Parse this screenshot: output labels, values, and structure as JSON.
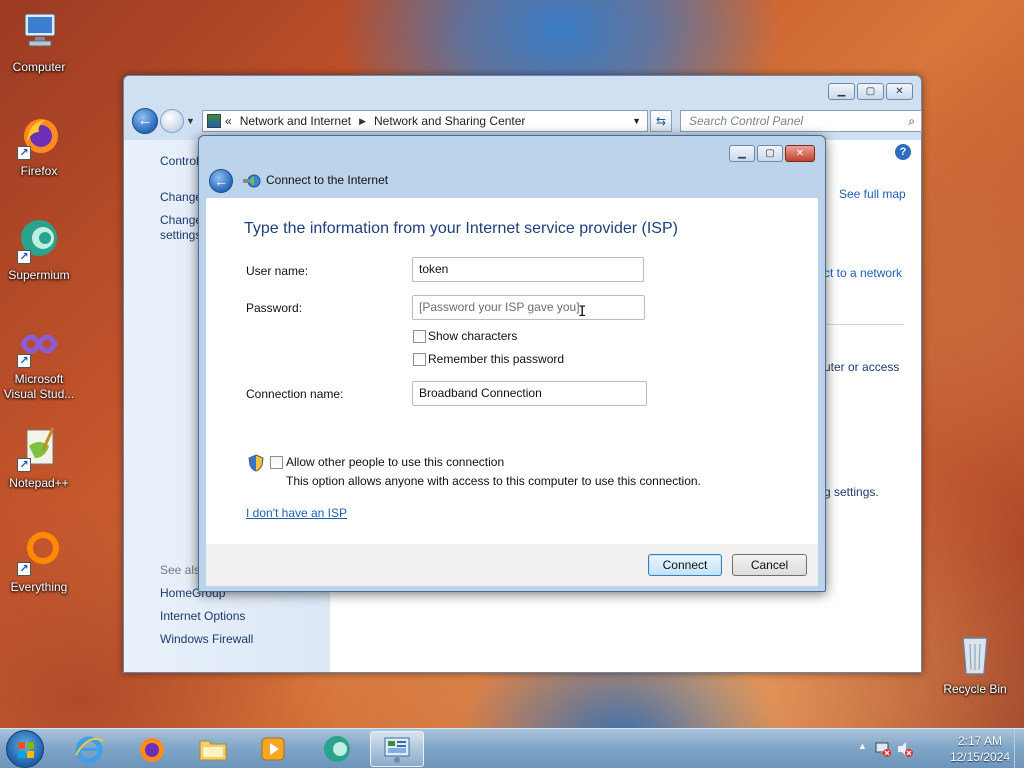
{
  "desktop": {
    "icons": [
      {
        "label": "Computer",
        "icon": "computer-icon"
      },
      {
        "label": "Firefox",
        "icon": "firefox-icon"
      },
      {
        "label": "Supermium",
        "icon": "supermium-icon"
      },
      {
        "label": "Microsoft Visual Stud...",
        "icon": "visual-studio-icon"
      },
      {
        "label": "Notepad++",
        "icon": "notepadpp-icon"
      },
      {
        "label": "Everything",
        "icon": "everything-icon"
      },
      {
        "label": "Recycle Bin",
        "icon": "recycle-bin-icon"
      }
    ]
  },
  "explorer": {
    "breadcrumb": [
      "Network and Internet",
      "Network and Sharing Center"
    ],
    "breadcrumb_prefix": "«",
    "search_placeholder": "Search Control Panel",
    "left_pane": {
      "control": "Control",
      "change1": "Change",
      "change2": "Change",
      "settings": "settings",
      "see_also": "See also",
      "homegroup": "HomeGroup",
      "internet_options": "Internet Options",
      "windows_firewall": "Windows Firewall"
    },
    "right_pane": {
      "see_full_map": "See full map",
      "connect_to_network": "ct to a network",
      "router_access": "uter or access",
      "sharing_settings": "g settings."
    }
  },
  "dialog": {
    "title": "Connect to the Internet",
    "heading": "Type the information from your Internet service provider (ISP)",
    "username_label": "User name:",
    "username_value": "token",
    "password_label": "Password:",
    "password_placeholder": "[Password your ISP gave you]",
    "show_characters": "Show characters",
    "remember_password": "Remember this password",
    "connection_name_label": "Connection name:",
    "connection_name_value": "Broadband Connection",
    "allow_others": "Allow other people to use this connection",
    "allow_others_desc": "This option allows anyone with access to this computer to use this connection.",
    "no_isp_link": "I don't have an ISP",
    "connect_button": "Connect",
    "cancel_button": "Cancel"
  },
  "taskbar": {
    "items": [
      "internet-explorer",
      "firefox",
      "file-explorer",
      "media-player",
      "supermium",
      "control-panel"
    ],
    "time": "2:17 AM",
    "date": "12/15/2024"
  }
}
